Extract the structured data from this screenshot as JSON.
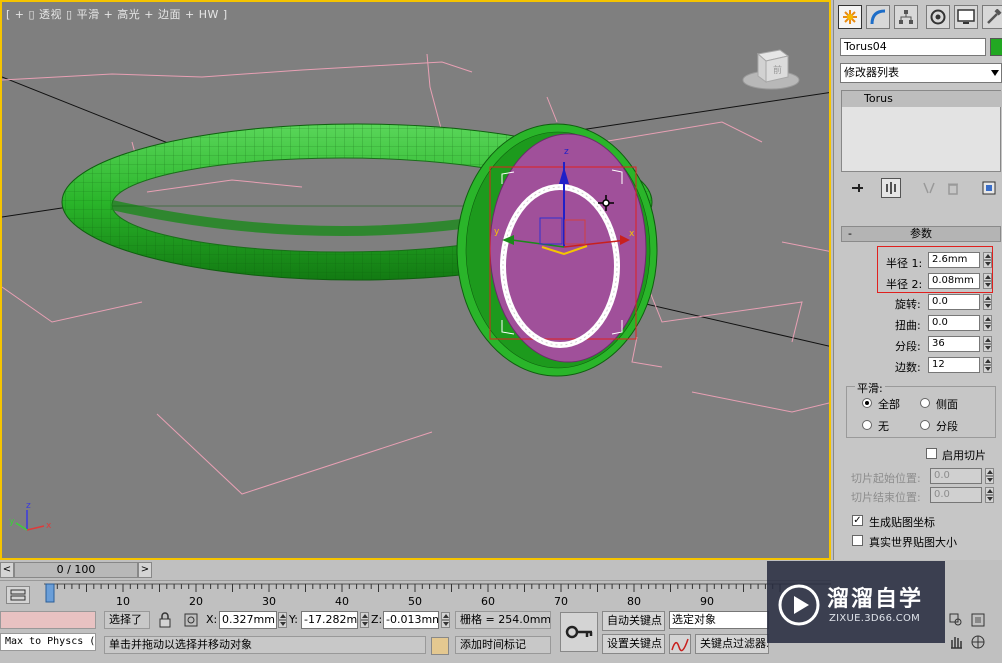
{
  "viewport": {
    "label": "[ + ▯ 透视 ▯ 平滑 + 高光 + 边面 + HW ]",
    "viewcube_text": "前"
  },
  "command_panel": {
    "object_name": "Torus04",
    "object_color": "#22a822",
    "modifier_list": "修改器列表",
    "modifier_stack": [
      "Torus"
    ],
    "rollout_title": "参数",
    "params": {
      "radius1_label": "半径 1:",
      "radius1": "2.6mm",
      "radius2_label": "半径 2:",
      "radius2": "0.08mm",
      "rotation_label": "旋转:",
      "rotation": "0.0",
      "twist_label": "扭曲:",
      "twist": "0.0",
      "segments_label": "分段:",
      "segments": "36",
      "sides_label": "边数:",
      "sides": "12"
    },
    "smooth": {
      "title": "平滑:",
      "all": "全部",
      "side": "侧面",
      "none": "无",
      "segment": "分段"
    },
    "slice": {
      "enable_label": "启用切片",
      "from_label": "切片起始位置:",
      "from": "0.0",
      "to_label": "切片结束位置:",
      "to": "0.0"
    },
    "gen_map_coords": "生成贴图坐标",
    "real_world": "真实世界贴图大小"
  },
  "timeline": {
    "frame": "0 / 100",
    "prev": "<",
    "next": ">",
    "ticks": [
      "10",
      "20",
      "30",
      "40",
      "50",
      "60",
      "70",
      "80",
      "90"
    ]
  },
  "status": {
    "maxscript": "Max to Physcs (",
    "selected": "选择了",
    "x_label": "X:",
    "x": "0.327mm",
    "y_label": "Y:",
    "y": "-17.282mm",
    "z_label": "Z:",
    "z": "-0.013mm",
    "grid": "栅格 = 254.0mm",
    "prompt": "单击并拖动以选择并移动对象",
    "add_time_tag": "添加时间标记",
    "auto_key": "自动关键点",
    "set_key": "设置关键点",
    "selection_set": "选定对象",
    "key_filters": "关键点过滤器..."
  },
  "watermark": {
    "title": "溜溜自学",
    "url": "ZIXUE.3D66.COM"
  },
  "colors": {
    "viewport_bg": "#7f7f7f",
    "viewport_border": "#f5c400",
    "ring": "#2dba2d",
    "bezel": "#a0509a",
    "grid_pink": "#e8a0b4"
  }
}
